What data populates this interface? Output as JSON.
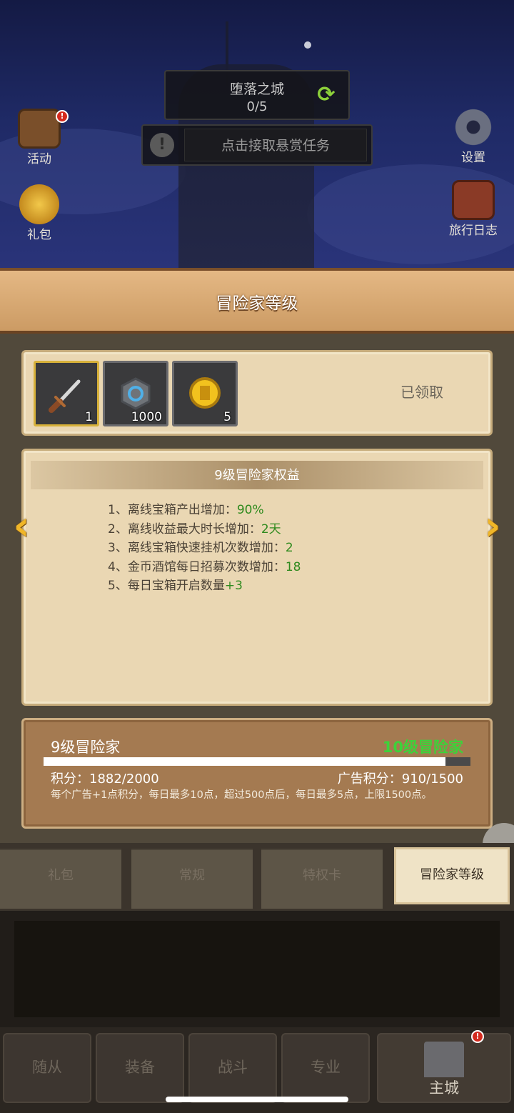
{
  "scene": {
    "region_name": "堕落之城",
    "region_progress": "0/5",
    "bounty_text": "点击接取悬赏任务",
    "left_buttons": [
      {
        "label": "活动",
        "icon": "event-scroll-icon",
        "badge": "!"
      },
      {
        "label": "礼包",
        "icon": "gift-pack-icon"
      }
    ],
    "right_buttons": [
      {
        "label": "设置",
        "icon": "gear-icon"
      },
      {
        "label": "旅行日志",
        "icon": "travel-log-icon"
      }
    ]
  },
  "panel": {
    "title": "冒险家等级",
    "rewards": [
      {
        "icon": "dagger-icon",
        "qty": "1"
      },
      {
        "icon": "rune-stone-icon",
        "qty": "1000"
      },
      {
        "icon": "gold-medal-icon",
        "qty": "5"
      }
    ],
    "reward_status": "已领取",
    "benefits_title": "9级冒险家权益",
    "benefits": [
      {
        "text": "1、离线宝箱产出增加：",
        "value": "90%"
      },
      {
        "text": "2、离线收益最大时长增加：",
        "value": "2天"
      },
      {
        "text": "3、离线宝箱快速挂机次数增加：",
        "value": "2"
      },
      {
        "text": "4、金币酒馆每日招募次数增加：",
        "value": "18"
      },
      {
        "text": "5、每日宝箱开启数量",
        "value": "+3"
      }
    ],
    "level": {
      "current": "9级冒险家",
      "next": "10级冒险家",
      "progress_fraction": 0.941,
      "points": "积分：1882/2000",
      "ad_points": "广告积分：910/1500",
      "note": "每个广告+1点积分，每日最多10点，超过500点后，每日最多5点，上限1500点。"
    },
    "tabs": [
      "礼包",
      "常规",
      "特权卡",
      "冒险家等级"
    ],
    "active_tab": 3
  },
  "bottom_nav": [
    "随从",
    "装备",
    "战斗",
    "专业",
    "主城"
  ],
  "colors": {
    "accent_green": "#3dd23a",
    "value_green": "#2f8a1e",
    "arrow_gold": "#f0b628",
    "badge_red": "#d42a1e"
  }
}
